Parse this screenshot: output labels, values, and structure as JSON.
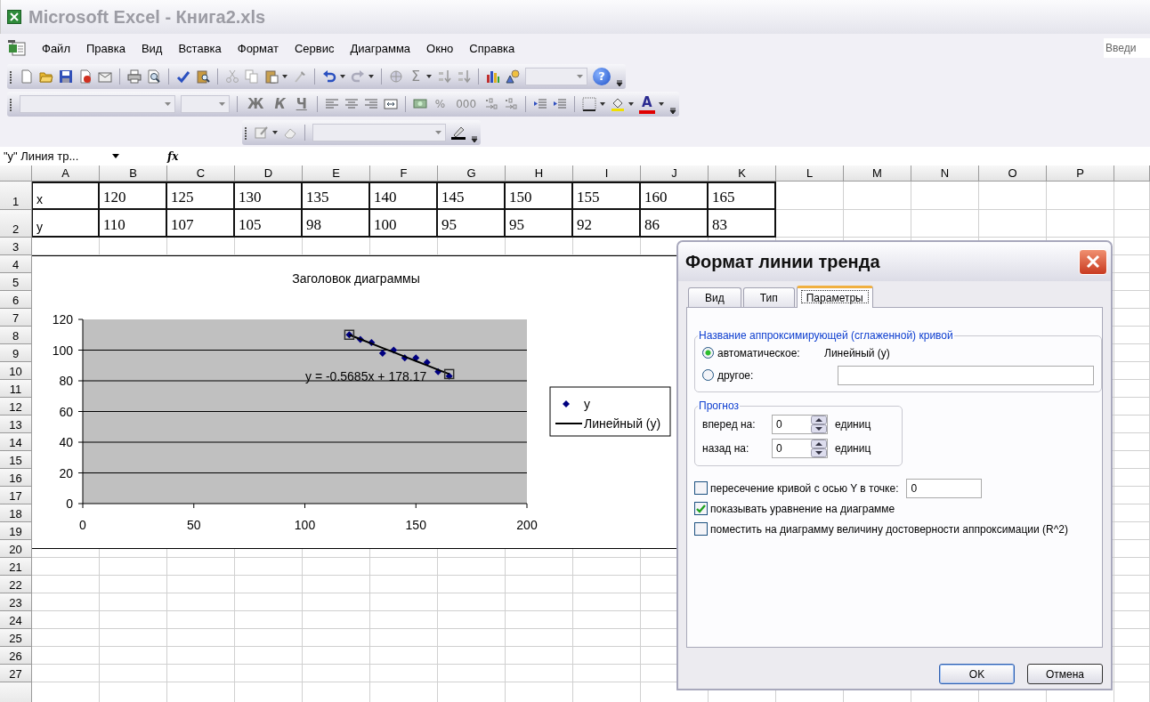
{
  "window": {
    "title": "Microsoft Excel - Книга2.xls"
  },
  "menu": [
    "Файл",
    "Правка",
    "Вид",
    "Вставка",
    "Формат",
    "Сервис",
    "Диаграмма",
    "Окно",
    "Справка"
  ],
  "help_box": {
    "placeholder": "Введи"
  },
  "toolbars": {
    "standard": {
      "text_buttons": [
        {
          "label": "Σ",
          "kind": "sum"
        },
        {
          "label": "?",
          "kind": "help"
        }
      ]
    },
    "formatting": {
      "text_buttons": [
        {
          "label": "Ж",
          "kind": "bold"
        },
        {
          "label": "К",
          "kind": "italic"
        },
        {
          "label": "Ч",
          "kind": "underline"
        },
        {
          "label": "%",
          "kind": "plain"
        },
        {
          "label": "000",
          "kind": "plain"
        },
        {
          "label": "A",
          "kind": "font-color"
        }
      ]
    }
  },
  "name_box": {
    "value": "\"y\" Линия тр..."
  },
  "formula_bar": {
    "label": "fx"
  },
  "sheet": {
    "columns": [
      "A",
      "B",
      "C",
      "D",
      "E",
      "F",
      "G",
      "H",
      "I",
      "J",
      "K",
      "L",
      "M",
      "N",
      "O",
      "P"
    ],
    "rows": [
      {
        "label": "1",
        "cells": [
          "x",
          "120",
          "125",
          "130",
          "135",
          "140",
          "145",
          "150",
          "155",
          "160",
          "165"
        ]
      },
      {
        "label": "2",
        "cells": [
          "y",
          "110",
          "107",
          "105",
          "98",
          "100",
          "95",
          "95",
          "92",
          "86",
          "83"
        ]
      },
      {
        "label": "3"
      },
      {
        "label": "4"
      },
      {
        "label": "5"
      },
      {
        "label": "6"
      },
      {
        "label": "7"
      },
      {
        "label": "8"
      },
      {
        "label": "9"
      },
      {
        "label": "10"
      },
      {
        "label": "11"
      },
      {
        "label": "12"
      },
      {
        "label": "13"
      },
      {
        "label": "14"
      },
      {
        "label": "15"
      },
      {
        "label": "16"
      },
      {
        "label": "17"
      },
      {
        "label": "18"
      },
      {
        "label": "19"
      },
      {
        "label": "20"
      },
      {
        "label": "21"
      },
      {
        "label": "22"
      },
      {
        "label": "23"
      },
      {
        "label": "24"
      },
      {
        "label": "25"
      },
      {
        "label": "26"
      },
      {
        "label": "27"
      }
    ]
  },
  "chart": {
    "chart_data": {
      "type": "scatter",
      "title": "Заголовок диаграммы",
      "x": [
        120,
        125,
        130,
        135,
        140,
        145,
        150,
        155,
        160,
        165
      ],
      "series": [
        {
          "name": "y",
          "color": "#000080",
          "values": [
            110,
            107,
            105,
            98,
            100,
            95,
            95,
            92,
            86,
            83
          ]
        },
        {
          "name": "Линейный (y)",
          "type": "line",
          "color": "#000000",
          "values": [
            110.0,
            107.1,
            104.3,
            101.4,
            98.6,
            95.7,
            92.9,
            90.1,
            87.2,
            84.4
          ]
        }
      ],
      "grid": true,
      "legend": "right",
      "xlim": [
        0,
        200
      ],
      "ylim": [
        0,
        120
      ],
      "xticks": [
        0,
        50,
        100,
        150,
        200
      ],
      "yticks": [
        0,
        20,
        40,
        60,
        80,
        100,
        120
      ],
      "annotations": [
        "y = -0.5685x + 178.17"
      ]
    }
  },
  "dialog": {
    "title": "Формат линии тренда",
    "tabs": [
      {
        "label": "Вид",
        "selected": false
      },
      {
        "label": "Тип",
        "selected": false
      },
      {
        "label": "Параметры",
        "selected": true
      }
    ],
    "name_group": {
      "title": "Название аппроксимирующей (сглаженной) кривой",
      "options": [
        {
          "label": "автоматическое:",
          "kind": "auto",
          "selected": true,
          "value": "Линейный (y)"
        },
        {
          "label": "другое:",
          "kind": "custom",
          "selected": false
        }
      ]
    },
    "forecast": {
      "title": "Прогноз",
      "rows": [
        {
          "label": "вперед на:",
          "value": "0",
          "unit": "единиц"
        },
        {
          "label": "назад на:",
          "value": "0",
          "unit": "единиц"
        }
      ]
    },
    "options": [
      {
        "label": "пересечение кривой с осью Y в точке:",
        "checked": false,
        "value": "0"
      },
      {
        "label": "показывать уравнение на диаграмме",
        "checked": true
      },
      {
        "label": "поместить на диаграмму величину достоверности аппроксимации (R^2)",
        "checked": false
      }
    ],
    "buttons": [
      "OK",
      "Отмена"
    ]
  }
}
